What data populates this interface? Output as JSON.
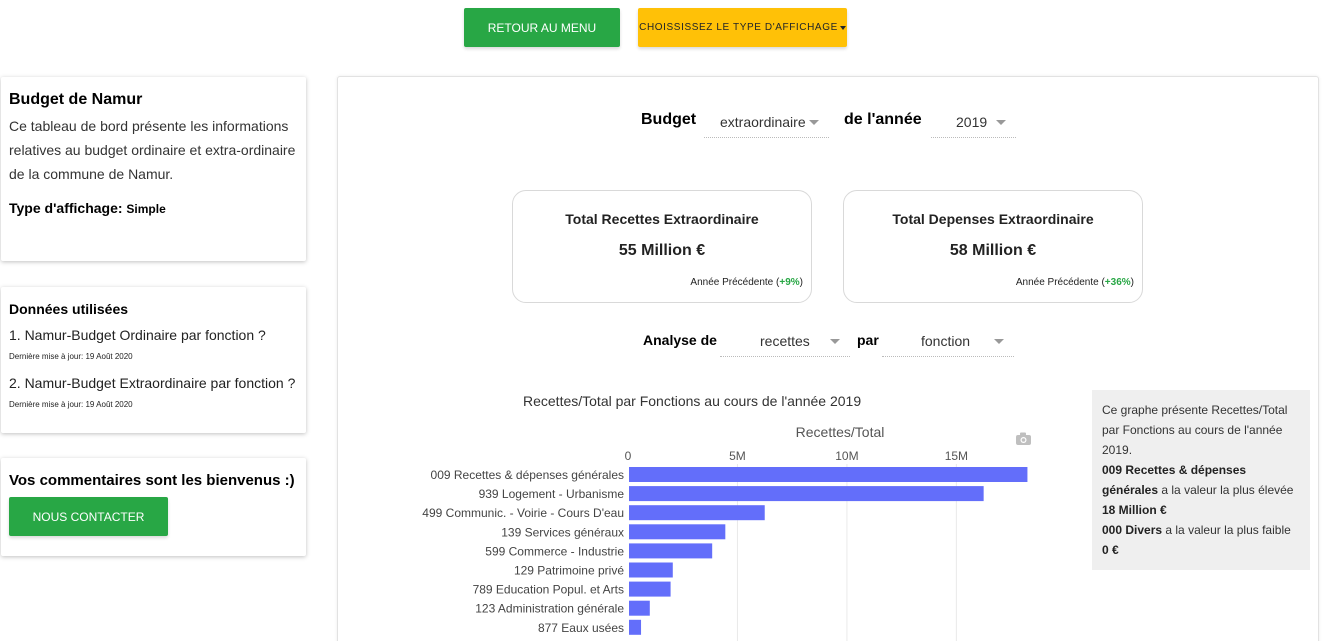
{
  "header": {
    "menu_button": "RETOUR AU MENU",
    "type_button": "CHOISSISSEZ LE TYPE D'AFFICHAGE"
  },
  "info_card": {
    "title": "Budget de Namur",
    "description": "Ce tableau de bord présente les informations relatives au budget ordinaire et extra-ordinaire de la commune de Namur.",
    "type_label": "Type d'affichage:",
    "type_value": "Simple"
  },
  "data_card": {
    "title": "Données utilisées",
    "items": [
      {
        "label": "1. Namur-Budget Ordinaire par fonction ?",
        "updated": "Dernière mise à jour: 19 Août 2020"
      },
      {
        "label": "2. Namur-Budget Extraordinaire par fonction ?",
        "updated": "Dernière mise à jour: 19 Août 2020"
      }
    ]
  },
  "comments_card": {
    "title": "Vos commentaires sont les bienvenus :)",
    "contact_button": "NOUS CONTACTER"
  },
  "controls": {
    "budget_label": "Budget",
    "budget_value": "extraordinaire",
    "year_label": "de l'année",
    "year_value": "2019",
    "analysis_label": "Analyse de",
    "analysis_value": "recettes",
    "by_label": "par",
    "by_value": "fonction"
  },
  "stats": [
    {
      "title": "Total Recettes Extraordinaire",
      "value": "55 Million €",
      "prev_label": "Année Précédente (",
      "prev_pct": "+9%",
      "prev_close": ")"
    },
    {
      "title": "Total Depenses Extraordinaire",
      "value": "58 Million €",
      "prev_label": "Année Précédente (",
      "prev_pct": "+36%",
      "prev_close": ")"
    }
  ],
  "chart_title_text": "Recettes/Total par Fonctions au cours de l'année 2019",
  "note": {
    "line1": "Ce graphe présente Recettes/Total par Fonctions au cours de l'année 2019.",
    "max_name": "009 Recettes & dépenses générales",
    "max_text": " a la valeur la plus élevée ",
    "max_value": "18 Million €",
    "min_name": "000 Divers",
    "min_text": " a la valeur la plus faible ",
    "min_value": "0 €"
  },
  "chart_data": {
    "type": "bar",
    "orientation": "horizontal",
    "title": "Recettes/Total par Fonctions au cours de l'année 2019",
    "xlabel": "Recettes/Total",
    "ylabel": "",
    "xlim": [
      0,
      18500000
    ],
    "xticks": [
      0,
      5000000,
      10000000,
      15000000
    ],
    "xtick_labels": [
      "0",
      "5M",
      "10M",
      "15M"
    ],
    "grid": true,
    "color": "#636efa",
    "categories": [
      "009 Recettes & dépenses générales",
      "939 Logement - Urbanisme",
      "499 Communic. - Voirie - Cours D'eau",
      "139 Services généraux",
      "599 Commerce - Industrie",
      "129 Patrimoine privé",
      "789 Education Popul. et Arts",
      "123 Administration générale",
      "877 Eaux usées"
    ],
    "values": [
      18200000,
      16200000,
      6200000,
      4400000,
      3800000,
      2000000,
      1900000,
      950000,
      550000
    ]
  }
}
